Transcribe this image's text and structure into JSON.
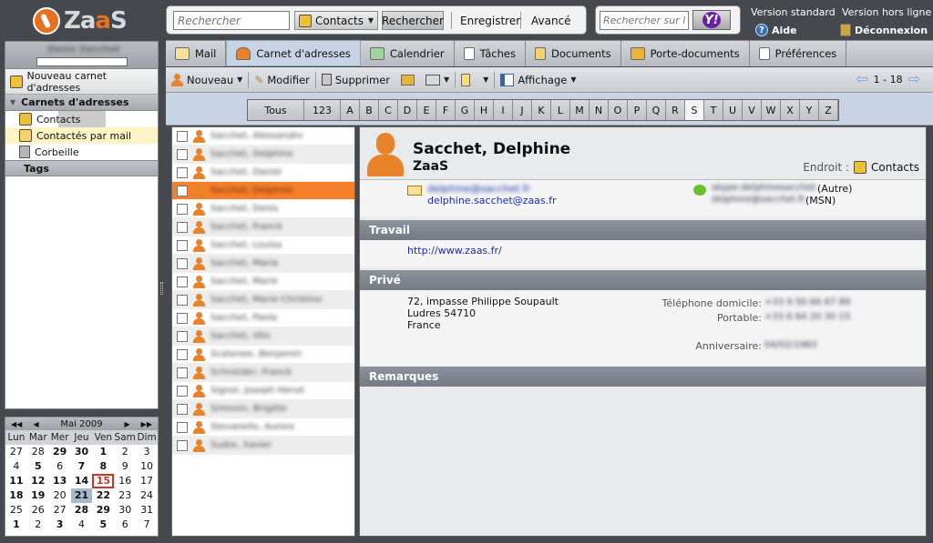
{
  "header": {
    "logo_text": "ZaaS",
    "search_placeholder": "Rechercher",
    "search_scope": "Contacts",
    "search_button": "Rechercher",
    "save_link": "Enregistrer",
    "advanced_link": "Avancé",
    "web_search_placeholder": "Rechercher sur le",
    "yahoo_label": "Y!",
    "version_standard": "Version standard",
    "version_offline": "Version hors ligne",
    "help": "Aide",
    "logout": "Déconnexion"
  },
  "sidebar": {
    "user_name": "Denis Sacchet",
    "new_addressbook": "Nouveau carnet d'adresses",
    "section_addressbooks": "Carnets d'adresses",
    "items": [
      {
        "label": "Contacts"
      },
      {
        "label": "Contactés par mail"
      },
      {
        "label": "Corbeille"
      }
    ],
    "section_tags": "Tags"
  },
  "calendar": {
    "month_label": "Mai 2009",
    "day_names": [
      "Lun",
      "Mar",
      "Mer",
      "Jeu",
      "Ven",
      "Sam",
      "Dim"
    ],
    "weeks": [
      [
        "27",
        "28",
        "29",
        "30",
        "1",
        "2",
        "3"
      ],
      [
        "4",
        "5",
        "6",
        "7",
        "8",
        "9",
        "10"
      ],
      [
        "11",
        "12",
        "13",
        "14",
        "15",
        "16",
        "17"
      ],
      [
        "18",
        "19",
        "20",
        "21",
        "22",
        "23",
        "24"
      ],
      [
        "25",
        "26",
        "27",
        "28",
        "29",
        "30",
        "31"
      ],
      [
        "1",
        "2",
        "3",
        "4",
        "5",
        "6",
        "7"
      ]
    ],
    "today": "15",
    "selected": "21"
  },
  "tabs": [
    {
      "label": "Mail"
    },
    {
      "label": "Carnet d'adresses"
    },
    {
      "label": "Calendrier"
    },
    {
      "label": "Tâches"
    },
    {
      "label": "Documents"
    },
    {
      "label": "Porte-documents"
    },
    {
      "label": "Préférences"
    }
  ],
  "toolbar": {
    "new": "Nouveau",
    "edit": "Modifier",
    "delete": "Supprimer",
    "view": "Affichage",
    "pager": "1 - 18"
  },
  "letters": [
    "Tous",
    "123",
    "A",
    "B",
    "C",
    "D",
    "E",
    "F",
    "G",
    "H",
    "I",
    "J",
    "K",
    "L",
    "M",
    "N",
    "O",
    "P",
    "Q",
    "R",
    "S",
    "T",
    "U",
    "V",
    "W",
    "X",
    "Y",
    "Z"
  ],
  "current_letter": "S",
  "contacts": [
    "Sacchet, Alessandro",
    "Sacchet, Delphine",
    "Sacchet, Daniel",
    "Sacchet, Delphine",
    "Sacchet, Denis",
    "Sacchet, Franck",
    "Sacchet, Louisa",
    "Sacchet, Maria",
    "Sacchet, Marie",
    "Sacchet, Marie-Christine",
    "Sacchet, Paola",
    "Sacchet, Vito",
    "Scatenee, Benjamin",
    "Schneider, Franck",
    "Signol, Joseph Hervé",
    "Simonin, Brigitte",
    "Stevanello, Aurore",
    "Sudre, Xavier"
  ],
  "selected_contact_index": 3,
  "detail": {
    "name": "Sacchet, Delphine",
    "company": "ZaaS",
    "location_label": "Endroit :",
    "location_value": "Contacts",
    "email_primary": "delphine@sacchet.fr",
    "email_secondary": "delphine.sacchet@zaas.fr",
    "im_1": "skype:delphinesacchet",
    "im_1_type": "(Autre)",
    "im_2": "delphine@sacchet.fr",
    "im_2_type": "(MSN)",
    "section_work": "Travail",
    "website": "http://www.zaas.fr/",
    "section_private": "Privé",
    "address_line1": "72, impasse Philippe Soupault",
    "address_line2": "Ludres 54710",
    "address_line3": "France",
    "home_phone_label": "Téléphone domicile:",
    "home_phone": "+33 9 50 66 67 89",
    "mobile_label": "Portable:",
    "mobile": "+33 6 64 20 30 15",
    "birthday_label": "Anniversaire:",
    "birthday": "04/02/1983",
    "section_notes": "Remarques"
  }
}
